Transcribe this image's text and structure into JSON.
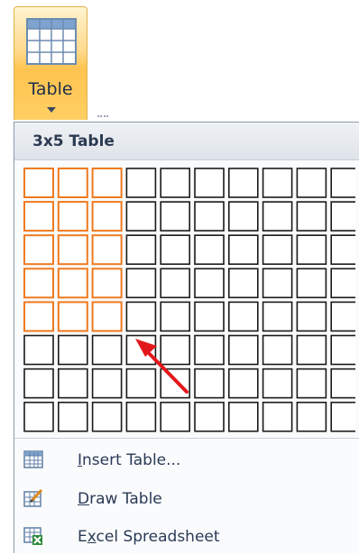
{
  "ribbon_button": {
    "label": "Table"
  },
  "menu": {
    "header": "3x5 Table",
    "grid": {
      "columns": 10,
      "rows": 8,
      "selected_columns": 3,
      "selected_rows": 5
    },
    "items": [
      {
        "key": "I",
        "rest": "nsert Table...",
        "icon": "insert-table-icon"
      },
      {
        "key": "D",
        "rest": "raw Table",
        "icon": "draw-table-icon"
      },
      {
        "key": "x",
        "pre": "E",
        "rest": "cel Spreadsheet",
        "icon": "excel-spreadsheet-icon"
      }
    ]
  },
  "colors": {
    "selected_border": "#f07a1e",
    "cell_border": "#1a1a1a",
    "arrow": "#e3181c"
  }
}
